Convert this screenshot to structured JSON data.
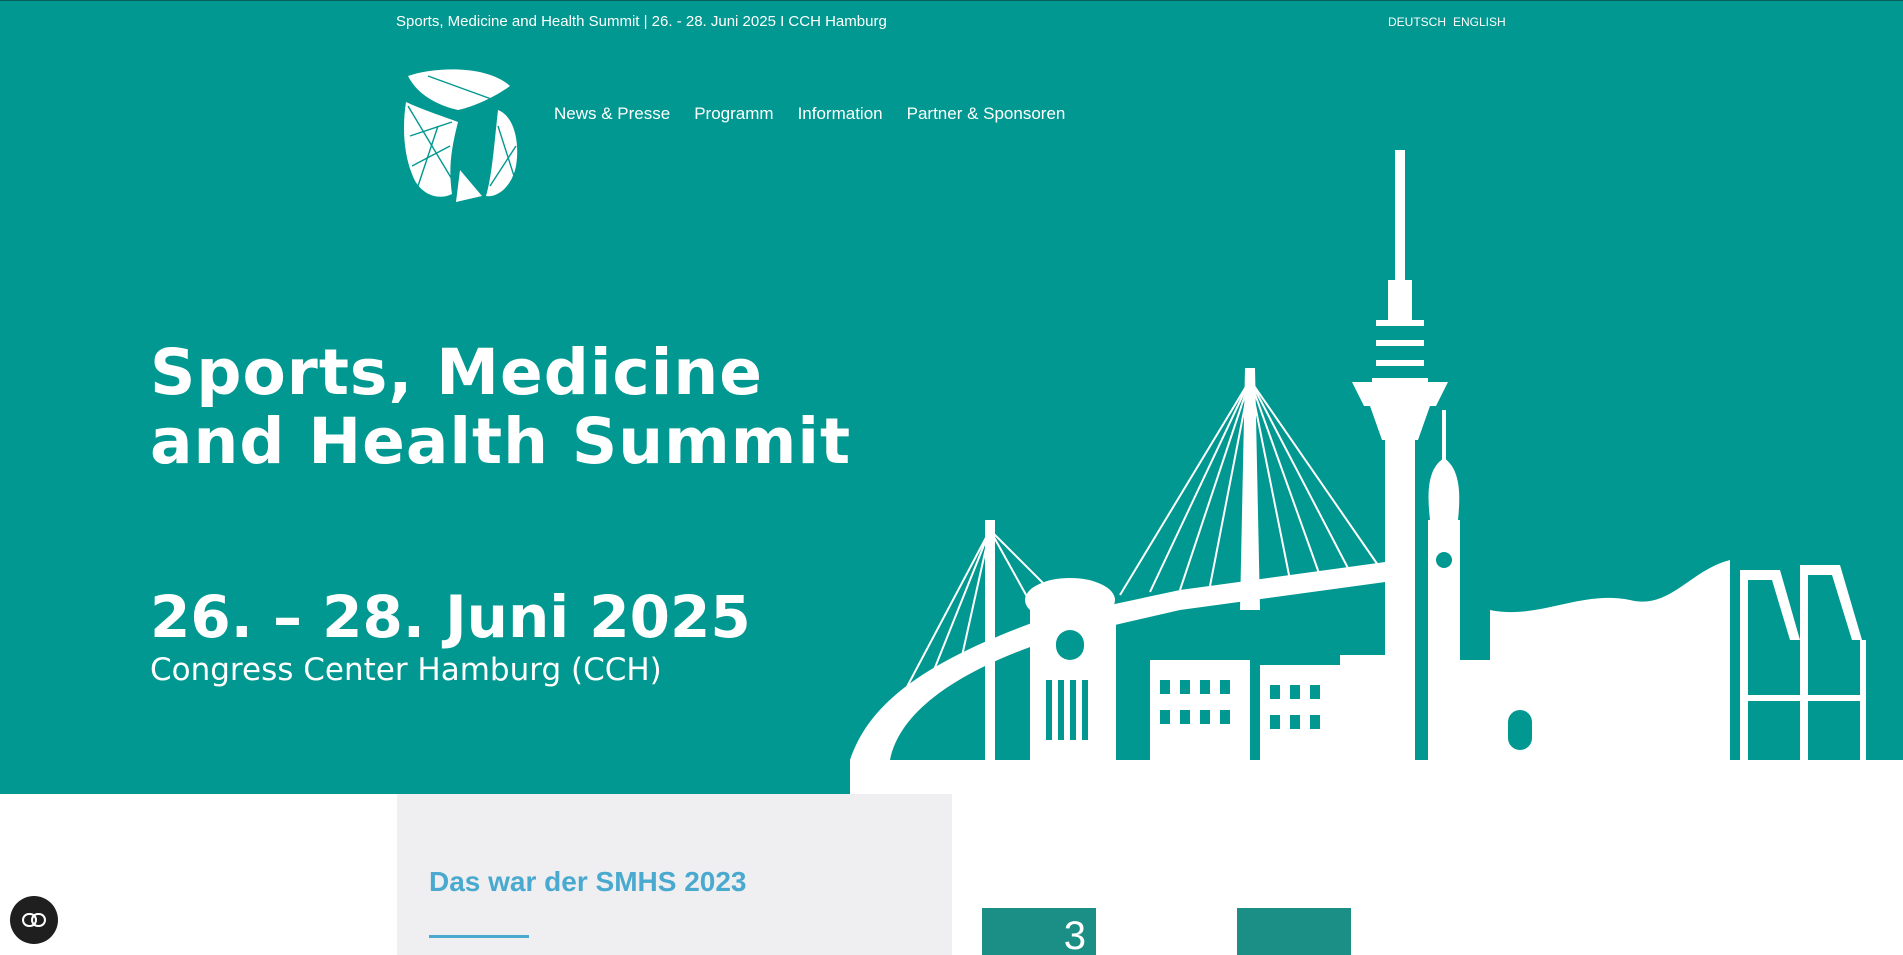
{
  "header": {
    "tagline": "Sports, Medicine and Health Summit | 26. - 28. Juni 2025 I CCH Hamburg",
    "languages": [
      "DEUTSCH",
      "ENGLISH"
    ]
  },
  "nav": {
    "items": [
      "News & Presse",
      "Programm",
      "Information",
      "Partner & Sponsoren"
    ]
  },
  "hero": {
    "title_line1": "Sports, Medicine",
    "title_line2": "and Health Summit",
    "date": "26. – 28. Juni 2025",
    "venue": "Congress Center Hamburg (CCH)"
  },
  "section": {
    "title": "Das war der SMHS 2023"
  },
  "cards": [
    {
      "number": "3"
    },
    {
      "number": ""
    }
  ],
  "icons": {
    "logo": "smhs-logo-icon",
    "cookie": "cookie-settings-icon"
  },
  "colors": {
    "primary": "#009890",
    "accent": "#4aa9cf",
    "panel": "#efeff1"
  }
}
